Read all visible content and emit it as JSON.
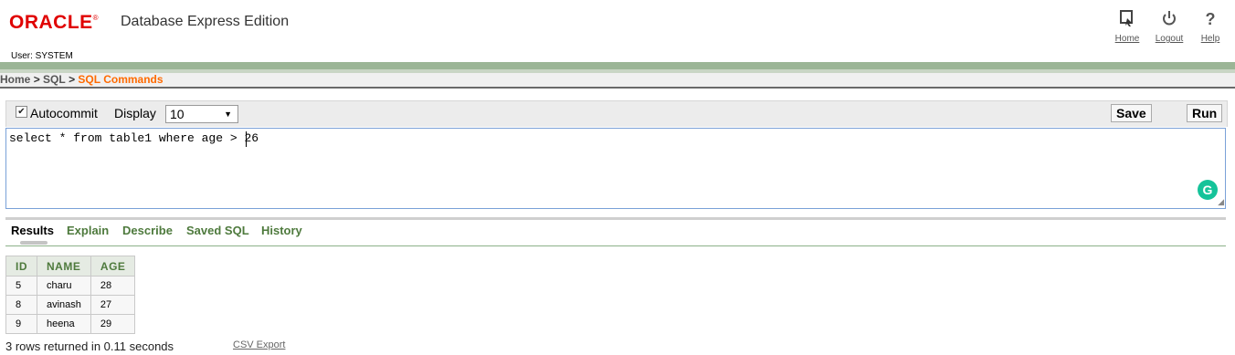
{
  "header": {
    "logo_text": "ORACLE",
    "logo_mark": "®",
    "product": "Database Express Edition",
    "user": "User: SYSTEM",
    "links": [
      {
        "label": "Home",
        "icon": "home-icon"
      },
      {
        "label": "Logout",
        "icon": "power-icon"
      },
      {
        "label": "Help",
        "icon": "question-icon"
      }
    ]
  },
  "breadcrumb": {
    "items": [
      "Home",
      "SQL",
      "SQL Commands"
    ],
    "separator": ">"
  },
  "toolbar": {
    "autocommit_label": "Autocommit",
    "autocommit_checked": true,
    "display_label": "Display",
    "display_value": "10",
    "save_label": "Save",
    "run_label": "Run"
  },
  "editor": {
    "query_before_caret": "select * from table1 where age >",
    "query_after_caret": " 26",
    "grammarly_glyph": "G"
  },
  "tabs": [
    "Results",
    "Explain",
    "Describe",
    "Saved SQL",
    "History"
  ],
  "results": {
    "columns": [
      "ID",
      "NAME",
      "AGE"
    ],
    "rows": [
      [
        "5",
        "charu",
        "28"
      ],
      [
        "8",
        "avinash",
        "27"
      ],
      [
        "9",
        "heena",
        "29"
      ]
    ],
    "status": "3 rows returned in 0.11 seconds",
    "csv_export": "CSV Export"
  },
  "colors": {
    "brand_red": "#e00000",
    "accent_green": "#4e7a3d",
    "breadcrumb_current": "#ff6a00"
  }
}
